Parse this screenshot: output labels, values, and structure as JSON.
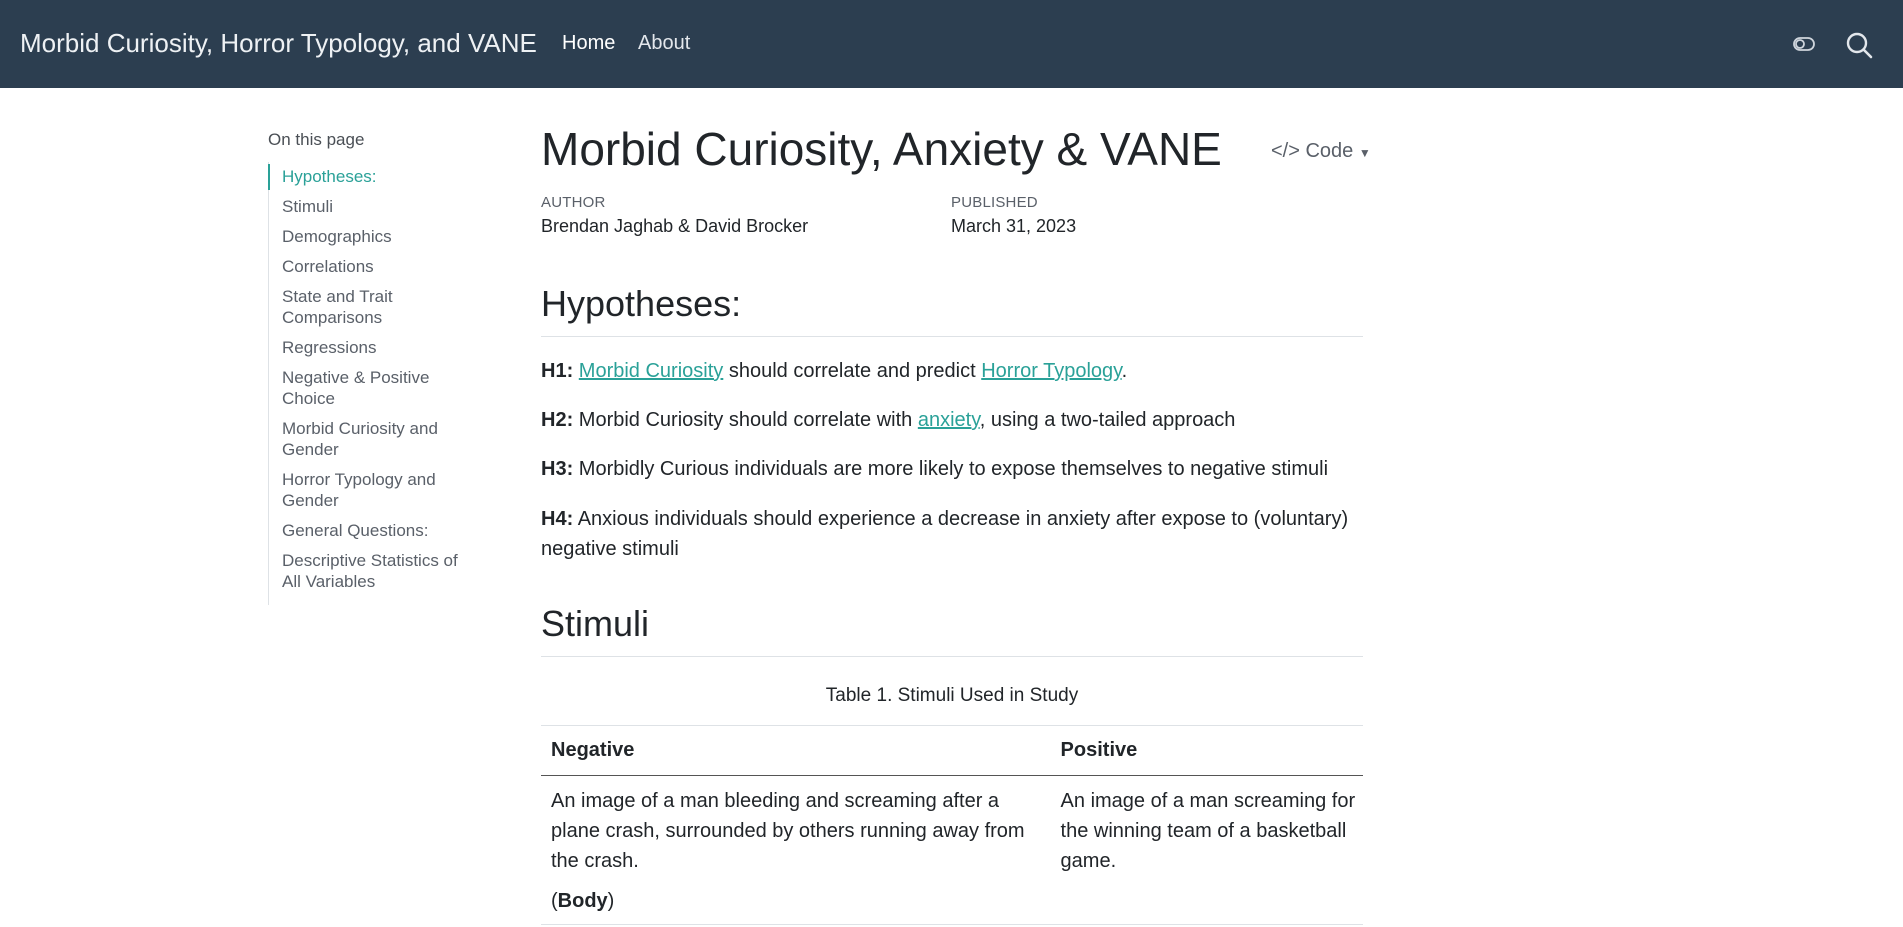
{
  "navbar": {
    "brand": "Morbid Curiosity, Horror Typology, and VANE",
    "links": [
      "Home",
      "About"
    ],
    "toggle_icon": "toggle-icon",
    "search_icon": "search-icon",
    "bg_color": "#2c3e50"
  },
  "toc": {
    "title": "On this page",
    "items": [
      "Hypotheses:",
      "Stimuli",
      "Demographics",
      "Correlations",
      "State and Trait Comparisons",
      "Regressions",
      "Negative & Positive Choice",
      "Morbid Curiosity and Gender",
      "Horror Typology and Gender",
      "General Questions:",
      "Descriptive Statistics of All Variables"
    ],
    "accent_color": "#2aa198"
  },
  "main": {
    "title": "Morbid Curiosity, Anxiety & VANE",
    "code_button": "Code",
    "author_label": "AUTHOR",
    "author_value": "Brendan Jaghab & David Brocker",
    "published_label": "PUBLISHED",
    "published_value": "March 31, 2023",
    "hypotheses_heading": "Hypotheses:",
    "h1": {
      "label": "H1:",
      "link1": "Morbid Curiosity",
      "text1": " should correlate and predict ",
      "link2": "Horror Typology",
      "text2": "."
    },
    "h2": {
      "label": "H2:",
      "text1": " Morbid Curiosity should correlate with ",
      "link1": "anxiety",
      "text2": ", using a two-tailed approach"
    },
    "h3": {
      "label": "H3:",
      "text1": " Morbidly Curious individuals are more likely to expose themselves to negative stimuli"
    },
    "h4": {
      "label": "H4:",
      "text1": " Anxious individuals should experience a decrease in anxiety after expose to (voluntary) negative stimuli"
    },
    "stimuli_heading": "Stimuli",
    "table": {
      "caption": "Table 1. Stimuli Used in Study",
      "headers": [
        "Negative",
        "Positive"
      ],
      "row1": {
        "negative": "An image of a man bleeding and screaming after a plane crash, surrounded by others running away from the crash.",
        "negative_tag_open": "(",
        "negative_tag": "Body",
        "negative_tag_close": ")",
        "positive": "An image of a man screaming for the winning team of a basketball game."
      }
    }
  }
}
